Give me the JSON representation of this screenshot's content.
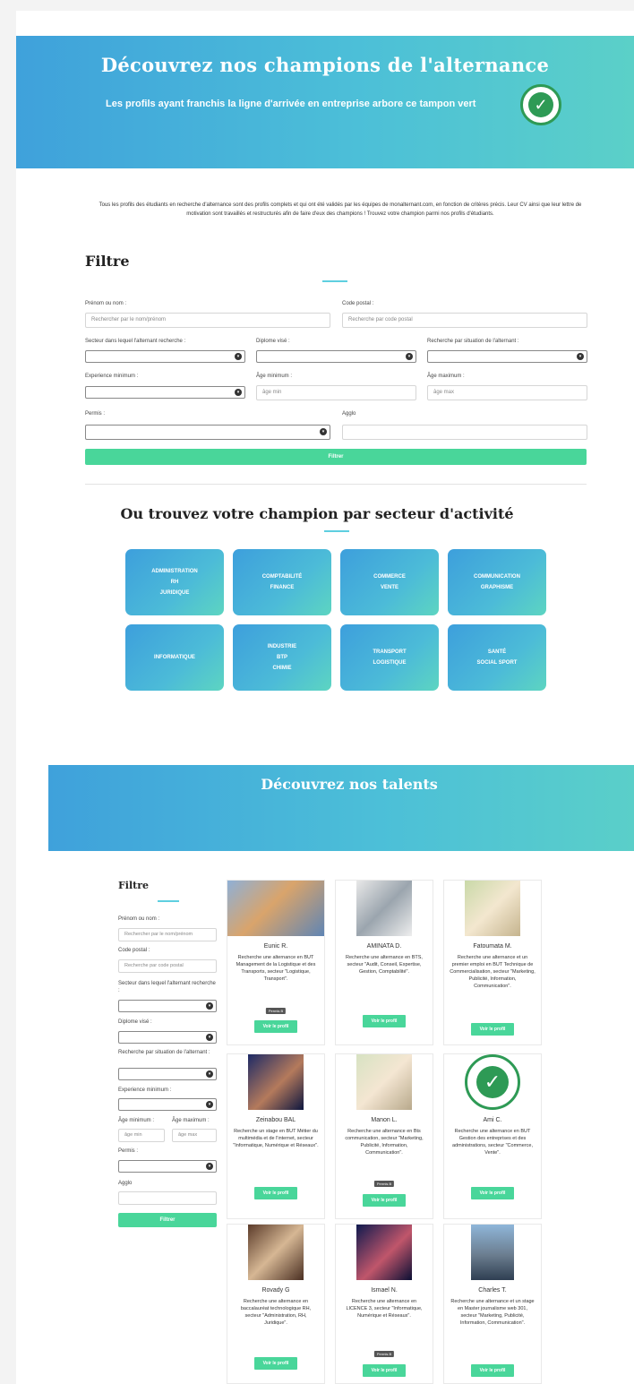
{
  "hero": {
    "title": "Découvrez nos champions de l'alternance",
    "subtitle": "Les profils ayant franchis la ligne d'arrivée en entreprise arbore ce tampon vert",
    "stamp_icon": "check-stamp-icon"
  },
  "intro": "Tous les profils des étudiants en recherche d'alternance sont des profils complets et qui ont été validés par les équipes de monalternant.com, en fonction de critères précis. Leur CV ainsi que leur lettre de motivation sont travaillés et restructurés afin de faire d'eux des champions ! Trouvez votre champion parmi nos profils d'étudiants.",
  "filter": {
    "title": "Filtre",
    "name_label": "Prénom ou nom :",
    "name_placeholder": "Rechercher par le nom/prénom",
    "postal_label": "Code postal :",
    "postal_placeholder": "Recherche par code postal",
    "sector_label": "Secteur dans lequel l'alternant recherche :",
    "diploma_label": "Diplome visé :",
    "situation_label": "Recherche par situation de l'alternant :",
    "experience_label": "Experience minimum :",
    "age_min_label": "Âge minimum :",
    "age_min_placeholder": "âge min",
    "age_max_label": "Âge maximum :",
    "age_max_placeholder": "âge max",
    "permis_label": "Permis :",
    "agglo_label": "Agglo",
    "submit": "Filtrer"
  },
  "sectors": {
    "title": "Ou trouvez votre champion par secteur d'activité",
    "tiles": [
      "ADMINISTRATION\nRH\nJURIDIQUE",
      "COMPTABILITÉ\nFINANCE",
      "COMMERCE\nVENTE",
      "COMMUNICATION\nGRAPHISME",
      "INFORMATIQUE",
      "INDUSTRIE\nBTP\nCHIMIE",
      "TRANSPORT\nLOGISTIQUE",
      "SANTÉ\nSOCIAL SPORT"
    ]
  },
  "talents": {
    "title": "Découvrez nos talents",
    "sidebar": {
      "title": "Filtre",
      "name_label": "Prénom ou nom :",
      "name_placeholder": "Rechercher par le nom/prénom",
      "postal_label": "Code postal :",
      "postal_placeholder": "Recherche par code postal",
      "sector_label": "Secteur dans lequel l'alternant recherche :",
      "diploma_label": "Diplome visé :",
      "situation_label": "Recherche par situation de l'alternant :",
      "experience_label": "Experience minimum :",
      "age_min_label": "Âge minimum :",
      "age_min_placeholder": "âge min",
      "age_max_label": "Âge maximum :",
      "age_max_placeholder": "âge max",
      "permis_label": "Permis :",
      "agglo_label": "Agglo",
      "submit": "Filtrer"
    },
    "view_label": "Voir le profil",
    "permis_badge": "Permis B",
    "cards": [
      {
        "name": "Eunic R.",
        "desc": "Recherche une alternance en BUT Management de la Logistique et des Transports, secteur \"Logistique, Transport\".",
        "badge": true,
        "stamp": false,
        "photo": "logistics-photo"
      },
      {
        "name": "AMINATA D.",
        "desc": "Recherche une alternance en BTS, secteur \"Audit, Conseil, Expertise, Gestion, Comptabilité\".",
        "badge": false,
        "stamp": false,
        "photo": "documents-photo"
      },
      {
        "name": "Fatoumata M.",
        "desc": "Recherche une alternance et un premier emploi en BUT Technique de Commercialisation, secteur \"Marketing, Publicité, Information, Communication\".",
        "badge": false,
        "stamp": false,
        "photo": "meeting-photo"
      },
      {
        "name": "Zeinabou BAL",
        "desc": "Recherche un stage en BUT Métier du multimédia et de l'internet, secteur \"Informatique, Numérique et Réseaux\".",
        "badge": false,
        "stamp": false,
        "photo": "portrait-photo"
      },
      {
        "name": "Manon L.",
        "desc": "Recherche une alternance en Bts communication, secteur \"Marketing, Publicité, Information, Communication\".",
        "badge": true,
        "stamp": false,
        "photo": "handshake-photo"
      },
      {
        "name": "Ami C.",
        "desc": "Recherche une alternance en BUT Gestion des entreprises et des administrations, secteur \"Commerce, Vente\".",
        "badge": false,
        "stamp": true,
        "photo": "stamp-photo"
      },
      {
        "name": "Rovady G",
        "desc": "Recherche une alternance en baccalauréat technologique RH, secteur \"Administration, RH, Juridique\".",
        "badge": false,
        "stamp": false,
        "photo": "office-photo"
      },
      {
        "name": "Ismael N.",
        "desc": "Recherche une alternance en LICENCE 3, secteur \"Informatique, Numérique et Réseaux\".",
        "badge": true,
        "stamp": false,
        "photo": "concert-photo"
      },
      {
        "name": "Charles T.",
        "desc": "Recherche une alternance et un stage en Master journalisme web 301, secteur \"Marketing, Publicité, Information, Communication\".",
        "badge": false,
        "stamp": false,
        "photo": "portrait-photo"
      }
    ]
  },
  "colors": {
    "accent": "#49d69a",
    "banner_start": "#3fa1db",
    "banner_end": "#5bd0c8",
    "stamp": "#2e9a55"
  }
}
